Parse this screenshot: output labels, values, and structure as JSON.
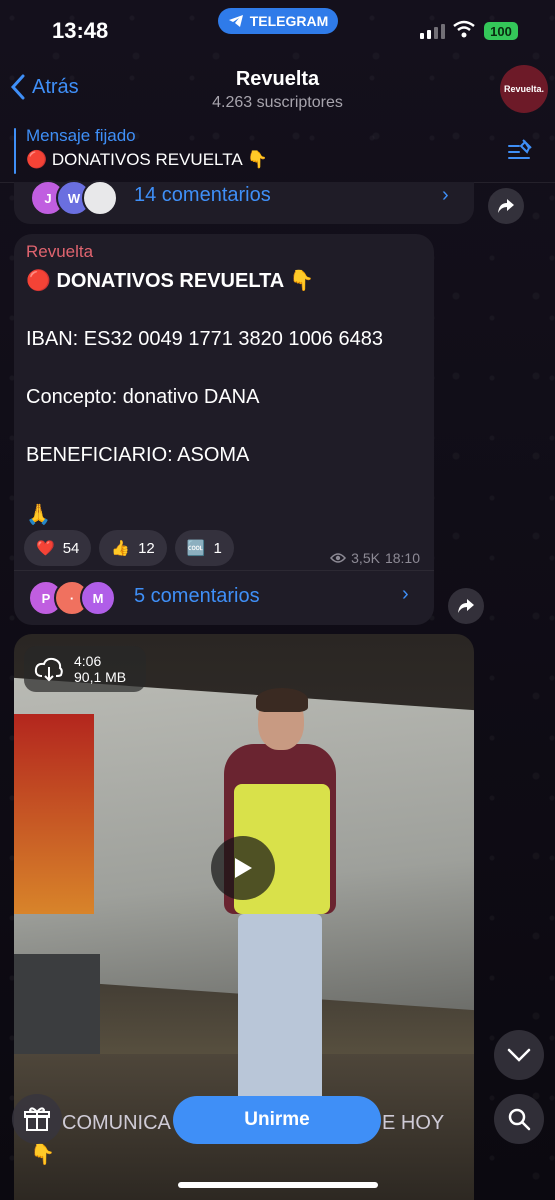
{
  "status_bar": {
    "time": "13:48",
    "app_pill": "TELEGRAM",
    "battery": "100"
  },
  "header": {
    "back_label": "Atrás",
    "title": "Revuelta",
    "subtitle": "4.263 suscriptores",
    "avatar_text": "Revuelta."
  },
  "pinned": {
    "label": "Mensaje fijado",
    "text": "🔴 DONATIVOS REVUELTA 👇"
  },
  "previous_post": {
    "faces": [
      "J",
      "W",
      ""
    ],
    "comments": "14 comentarios"
  },
  "message": {
    "author": "Revuelta",
    "lines": [
      "🔴 DONATIVOS REVUELTA 👇",
      "IBAN: ES32 0049 1771 3820 1006 6483",
      "Concepto: donativo DANA",
      "BENEFICIARIO: ASOMA",
      "🙏"
    ],
    "reactions": [
      {
        "emoji": "❤️",
        "count": "54"
      },
      {
        "emoji": "👍",
        "count": "12"
      },
      {
        "emoji": "🆒",
        "count": "1"
      }
    ],
    "views": "3,5K",
    "time": "18:10",
    "faces": [
      "P",
      "·",
      "M"
    ],
    "comments": "5 comentarios"
  },
  "video": {
    "duration": "4:06",
    "size": "90,1 MB",
    "ticker_left": "COMUNICA",
    "ticker_right": "E HOY",
    "ticker_emoji": "👇"
  },
  "join_button": "Unirme",
  "colors": {
    "accent": "#3f8ff7",
    "bubble": "#1f1c27",
    "author": "#e0646f"
  }
}
